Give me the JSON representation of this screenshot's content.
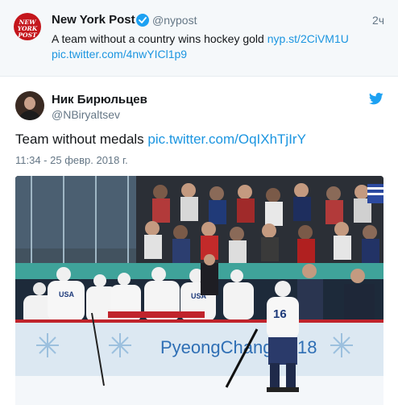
{
  "quoted_tweet": {
    "avatar_logo_text": "NEW YORK POST",
    "name": "New York Post",
    "handle": "@nypost",
    "time": "2ч",
    "text": "A team without a country wins hockey gold",
    "link1": "nyp.st/2CiVM1U",
    "link2": "pic.twitter.com/4nwYICl1p9"
  },
  "tweet": {
    "name": "Ник Бирюльцев",
    "handle": "@NBiryaltsev",
    "text": "Team without medals",
    "link": "pic.twitter.com/OqIXhTjIrY",
    "timestamp": "11:34 - 25 февр. 2018 г."
  },
  "photo": {
    "board_text": "PyeongChang 2018",
    "jersey_text": "USA",
    "jersey_number": "16"
  },
  "colors": {
    "link": "#1b95e0",
    "verified": "#1da1f2",
    "twitter_bird": "#1da1f2",
    "nypost_red": "#c4161c"
  },
  "icons": [
    "verified-icon",
    "twitter-bird-icon"
  ]
}
